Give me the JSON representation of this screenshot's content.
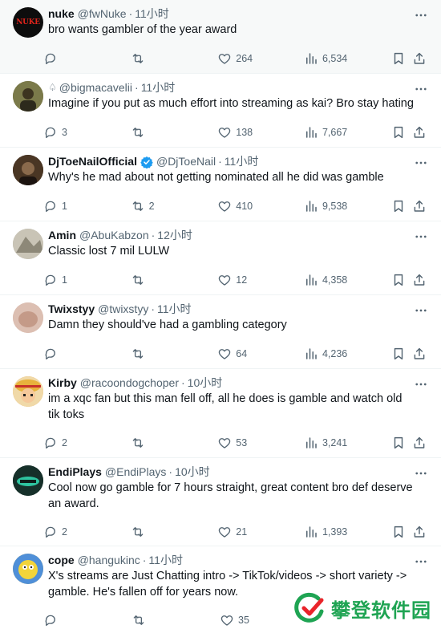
{
  "tweets": [
    {
      "name": "nuke",
      "handle": "@fwNuke",
      "sep": "·",
      "time": "11小时",
      "text": "bro wants gambler of the year award",
      "replies": "",
      "retweets": "",
      "likes": "264",
      "views": "6,534",
      "avatar_text": "NUKE",
      "avatar_color": "#0d0d0d"
    },
    {
      "name": "",
      "handle": "@bigmacavelii",
      "sep": "·",
      "time": "11小时",
      "text": "Imagine if you put as much effort into streaming as kai? Bro stay hating",
      "replies": "3",
      "retweets": "",
      "likes": "138",
      "views": "7,667",
      "avatar_color": "#6b6a3c"
    },
    {
      "name": "DjToeNailOfficial",
      "handle": "@DjToeNail",
      "sep": "·",
      "time": "11小时",
      "text": "Why's he mad about not getting nominated all he did was gamble",
      "replies": "1",
      "retweets": "2",
      "likes": "410",
      "views": "9,538",
      "avatar_color": "#3a2a1c",
      "verified": true
    },
    {
      "name": "Amin",
      "handle": "@AbuKabzon",
      "sep": "·",
      "time": "12小时",
      "text": "Classic lost 7 mil LULW",
      "replies": "1",
      "retweets": "",
      "likes": "12",
      "views": "4,358",
      "avatar_color": "#b9b4a6"
    },
    {
      "name": "Twixstyy",
      "handle": "@twixstyy",
      "sep": "·",
      "time": "11小时",
      "text": "Damn they should've had a gambling category",
      "replies": "",
      "retweets": "",
      "likes": "64",
      "views": "4,236",
      "avatar_color": "#d9b7a9"
    },
    {
      "name": "Kirby",
      "handle": "@racoondogchoper",
      "sep": "·",
      "time": "10小时",
      "text": "im a xqc fan but this man fell off, all he does is gamble and watch old tik toks",
      "replies": "2",
      "retweets": "",
      "likes": "53",
      "views": "3,241",
      "avatar_color": "#e8a23c"
    },
    {
      "name": "EndiPlays",
      "handle": "@EndiPlays",
      "sep": "·",
      "time": "10小时",
      "text": "Cool now go gamble for 7 hours straight, great content bro def deserve an award.",
      "replies": "2",
      "retweets": "",
      "likes": "21",
      "views": "1,393",
      "avatar_color": "#16302a"
    },
    {
      "name": "cope",
      "handle": "@hangukinc",
      "sep": "·",
      "time": "11小时",
      "text": "X's streams are Just Chatting intro -> TikTok/videos -> short variety -> gamble. He's fallen off for years now.",
      "replies": "",
      "retweets": "",
      "likes": "35",
      "views": "",
      "avatar_color": "#f2c230"
    }
  ],
  "watermark": {
    "text": "攀登软件园",
    "color": "#1fa453"
  },
  "colors": {
    "muted": "#536471",
    "verified": "#1d9bf0",
    "divider": "#eff3f4"
  }
}
